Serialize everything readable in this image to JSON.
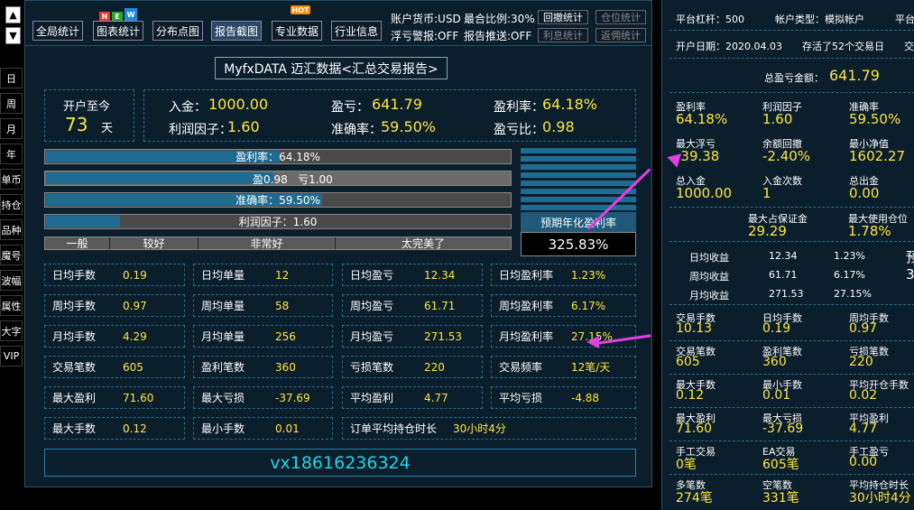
{
  "nav": {
    "up_arrow": "▲",
    "down_arrow": "▼",
    "items": [
      "日",
      "周",
      "月",
      "年",
      "单币",
      "持仓",
      "品种",
      "魔号",
      "波幅",
      "属性",
      "大字",
      "VIP"
    ]
  },
  "toolbar": {
    "buttons": [
      "全局统计",
      "图表统计",
      "分布点图",
      "报告截图",
      "专业数据",
      "行业信息"
    ],
    "badge_new": [
      "N",
      "E",
      "W"
    ],
    "badge_hot": "HOT",
    "info": [
      "账户货币:USD",
      "最合比例:30%",
      "浮亏警报:OFF",
      "报告推送:OFF"
    ],
    "small_buttons": [
      "回撤统计",
      "仓位统计",
      "利息统计",
      "返佣统计"
    ]
  },
  "title": "MyfxDATA 迈汇数据<汇总交易报告>",
  "open_days": {
    "label": "开户至今",
    "value": "73",
    "unit": "天"
  },
  "summary": {
    "deposit_label": "入金：",
    "deposit": "1000.00",
    "profit_label": "盈亏：",
    "profit": "641.79",
    "profit_rate_label": "盈利率：",
    "profit_rate": "64.18%",
    "profit_factor_label": "利润因子：",
    "profit_factor": "1.60",
    "accuracy_label": "准确率：",
    "accuracy": "59.50%",
    "pl_ratio_label": "盈亏比：",
    "pl_ratio": "0.98"
  },
  "bars": {
    "profit_rate": {
      "label": "盈利率：64.18%",
      "fraction": 0.503
    },
    "pl": {
      "left": "盈0.98",
      "right": "亏1.00",
      "fraction": 0.49
    },
    "accuracy": {
      "label": "准确率：59.50%",
      "fraction": 0.595
    },
    "factor": {
      "label": "利润因子：1.60",
      "fraction": 0.16
    }
  },
  "scale": [
    "一般",
    "较好",
    "非常好",
    "太完美了"
  ],
  "annual": {
    "label": "预期年化盈利率",
    "value": "325.83%"
  },
  "stats": [
    [
      "日均手数",
      "0.19",
      "日均单量",
      "12",
      "日均盈亏",
      "12.34",
      "日均盈利率",
      "1.23%"
    ],
    [
      "周均手数",
      "0.97",
      "周均单量",
      "58",
      "周均盈亏",
      "61.71",
      "周均盈利率",
      "6.17%"
    ],
    [
      "月均手数",
      "4.29",
      "月均单量",
      "256",
      "月均盈亏",
      "271.53",
      "月均盈利率",
      "27.15%"
    ],
    [
      "交易笔数",
      "605",
      "盈利笔数",
      "360",
      "亏损笔数",
      "220",
      "交易频率",
      "12笔/天"
    ],
    [
      "最大盈利",
      "71.60",
      "最大亏损",
      "-37.69",
      "平均盈利",
      "4.77",
      "平均亏损",
      "-4.88"
    ]
  ],
  "last_row": [
    "最大手数",
    "0.12",
    "最小手数",
    "0.01",
    "订单平均持仓时长",
    "30小时4分"
  ],
  "contact": "vx18616236324",
  "right": {
    "leverage": "平台杠杆：500",
    "account_type": "帐户类型：模拟帐户",
    "platform_cut": "平台",
    "open_date": "开户日期：2020.04.03",
    "survived": "存活了52个交易日",
    "cut2": "交",
    "total_profit_label": "总盈亏金额：",
    "total_profit": "641.79",
    "grid1": [
      [
        "盈利率",
        "64.18%"
      ],
      [
        "利润因子",
        "1.60"
      ],
      [
        "准确率",
        "59.50%"
      ],
      [
        "最大浮亏",
        "-39.38"
      ],
      [
        "余额回撤",
        "-2.40%"
      ],
      [
        "最小净值",
        "1602.27"
      ],
      [
        "总入金",
        "1000.00"
      ],
      [
        "入金次数",
        "1"
      ],
      [
        "总出金",
        "0.00"
      ]
    ],
    "margin": [
      [
        "最大占保证金",
        "29.29"
      ],
      [
        "最大使用仓位",
        "1.78%"
      ]
    ],
    "income": [
      [
        "日均收益",
        "12.34",
        "1.23%",
        "预"
      ],
      [
        "周均收益",
        "61.71",
        "6.17%",
        "3"
      ],
      [
        "月均收益",
        "271.53",
        "27.15%",
        ""
      ]
    ],
    "grid2": [
      [
        "交易手数",
        "10.13"
      ],
      [
        "日均手数",
        "0.19"
      ],
      [
        "周均手数",
        "0.97"
      ],
      [
        "交易笔数",
        "605"
      ],
      [
        "盈利笔数",
        "360"
      ],
      [
        "亏损笔数",
        "220"
      ],
      [
        "最大手数",
        "0.12"
      ],
      [
        "最小手数",
        "0.01"
      ],
      [
        "平均开仓手数",
        "0.02"
      ],
      [
        "最大盈利",
        "71.60"
      ],
      [
        "最大亏损",
        "-37.69"
      ],
      [
        "平均盈利",
        "4.77"
      ],
      [
        "手工交易",
        "0笔"
      ],
      [
        "EA交易",
        "605笔"
      ],
      [
        "手工盈亏",
        "0.00"
      ],
      [
        "多笔数",
        "274笔"
      ],
      [
        "空笔数",
        "331笔"
      ],
      [
        "平均持仓时长",
        "30小时4分"
      ]
    ]
  },
  "colors": {
    "accent": "#ffe640",
    "panel": "#0b1e2c",
    "bar_fill": "#1f6c92",
    "arrow": "#e040e0"
  }
}
